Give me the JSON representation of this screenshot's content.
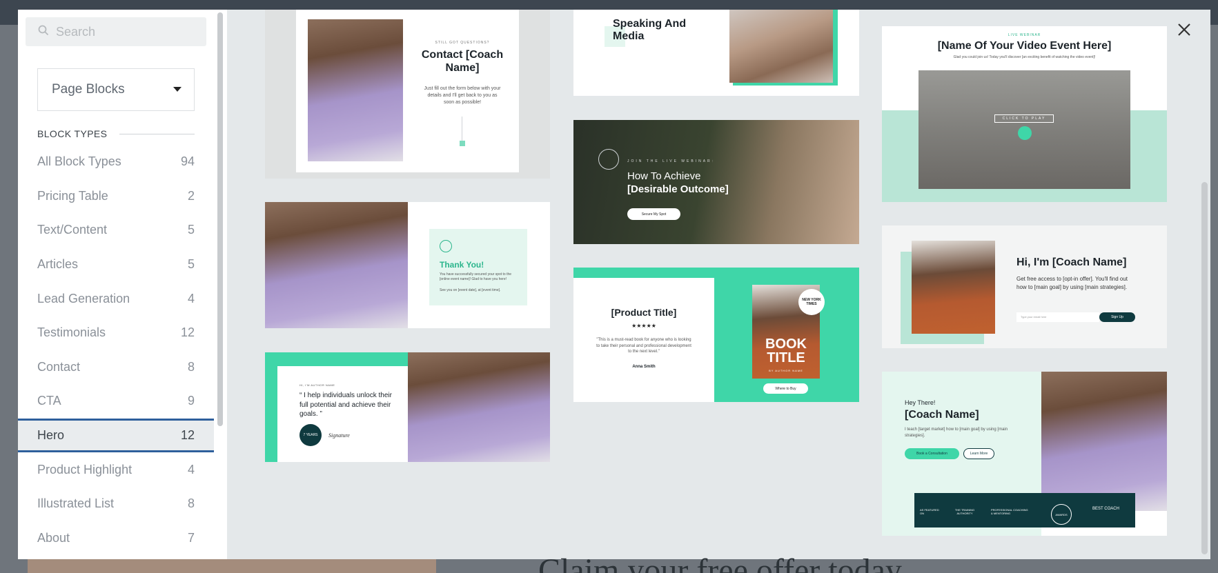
{
  "search": {
    "placeholder": "Search"
  },
  "dropdown": {
    "selected": "Page Blocks"
  },
  "block_types_heading": "BLOCK TYPES",
  "block_types": [
    {
      "label": "All Block Types",
      "count": "94"
    },
    {
      "label": "Pricing Table",
      "count": "2"
    },
    {
      "label": "Text/Content",
      "count": "5"
    },
    {
      "label": "Articles",
      "count": "5"
    },
    {
      "label": "Lead Generation",
      "count": "4"
    },
    {
      "label": "Testimonials",
      "count": "12"
    },
    {
      "label": "Contact",
      "count": "8"
    },
    {
      "label": "CTA",
      "count": "9"
    },
    {
      "label": "Hero",
      "count": "12"
    },
    {
      "label": "Product Highlight",
      "count": "4"
    },
    {
      "label": "Illustrated List",
      "count": "8"
    },
    {
      "label": "About",
      "count": "7"
    }
  ],
  "active_type": "Hero",
  "thumbs": {
    "contact": {
      "kicker": "STILL GOT QUESTIONS?",
      "title": "Contact [Coach Name]",
      "body": "Just fill out the form below with your details and I'll get back to you as soon as possible!"
    },
    "thankyou": {
      "title": "Thank You!",
      "body": "You have successfully secured your spot to the [online event name]! Glad to have you here!",
      "body2": "See you on [event date], at [event time]."
    },
    "quote": {
      "kicker": "HI, I'M AUTHOR NAME",
      "quote": "“ I help individuals unlock their full potential and achieve their goals. ”",
      "badge": "7 YEARS",
      "signature": "Signature"
    },
    "speaking": {
      "title": "Speaking And Media"
    },
    "webinar": {
      "kicker": "JOIN THE LIVE WEBINAR:",
      "title1": "How To Achieve",
      "title2": "[Desirable Outcome]",
      "cta": "Secure My Spot"
    },
    "product": {
      "title": "[Product Title]",
      "stars": "★★★★★",
      "quote": "\"This is a must-read book for anyone who is looking to take their personal and professional development to the next level.\"",
      "author": "Anna Smith",
      "book_badge": "NEW YORK TIMES",
      "book_title": "BOOK TITLE",
      "book_author": "BY AUTHOR NAME",
      "cta": "Where to Buy"
    },
    "video": {
      "kicker": "LIVE WEBINAR",
      "title": "[Name Of Your Video Event Here]",
      "sub": "Glad you could join us! Today you'll discover [an exciting benefit of watching the video event]!",
      "play": "CLICK TO PLAY"
    },
    "optin": {
      "title": "Hi, I'm [Coach Name]",
      "body": "Get free access to [opt-in offer]. You'll find out how to [main goal] by using [main strategies].",
      "email_placeholder": "Type your email here",
      "cta": "Sign Up"
    },
    "hero": {
      "kicker": "Hey There!",
      "title": "[Coach Name]",
      "body": "I teach [target market] how to [main goal] by using [main strategies].",
      "cta1": "Book a Consultation",
      "cta2": "Learn More",
      "featured": "AS FEATURED ON",
      "logo1": "THE TRAINING AUTHORITY",
      "logo2": "PROFESSIONAL COACHING & MENTORING",
      "logo3": "AWARDS",
      "logo4": "BEST COACH"
    }
  },
  "background_text": "Claim your free offer today"
}
